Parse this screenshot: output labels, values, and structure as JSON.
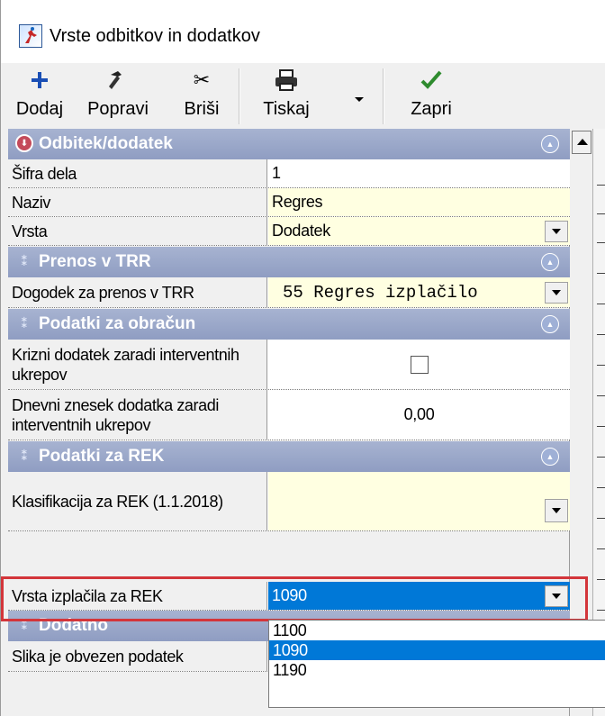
{
  "window": {
    "title": "Vrste odbitkov in dodatkov"
  },
  "toolbar": {
    "add_label": "Dodaj",
    "edit_label": "Popravi",
    "delete_label": "Briši",
    "print_label": "Tiskaj",
    "close_label": "Zapri"
  },
  "sections": {
    "deduction": {
      "title": "Odbitek/dodatek",
      "rows": {
        "code": {
          "label": "Šifra dela",
          "value": "1"
        },
        "name": {
          "label": "Naziv",
          "value": "Regres"
        },
        "type": {
          "label": "Vrsta",
          "value": "Dodatek"
        }
      }
    },
    "transfer": {
      "title": "Prenos v TRR",
      "rows": {
        "event": {
          "label": "Dogodek za prenos v TRR",
          "value": "55 Regres izplačilo"
        }
      }
    },
    "calculation": {
      "title": "Podatki za obračun",
      "rows": {
        "crisis_bonus": {
          "label": "Krizni dodatek zaradi interventnih ukrepov",
          "checked": false
        },
        "daily_amount": {
          "label": "Dnevni znesek dodatka zaradi interventnih ukrepov",
          "value": "0,00"
        }
      }
    },
    "rek": {
      "title": "Podatki za REK",
      "rows": {
        "classification": {
          "label": "Klasifikacija za REK (1.1.2018)",
          "value": ""
        },
        "payout_type": {
          "label": "Vrsta izplačila za REK",
          "value": "1090"
        }
      }
    },
    "extra": {
      "title": "Dodatno",
      "rows": {
        "image_required": {
          "label": "Slika je obvezen podatek"
        }
      }
    }
  },
  "dropdown": {
    "options": [
      "1100",
      "1090",
      "1190"
    ],
    "selected_index": 1
  },
  "colors": {
    "section_header": "#9aa7ca",
    "selection": "#0078d7",
    "editable_field": "#ffffe1",
    "highlight_box": "#d3353a"
  }
}
